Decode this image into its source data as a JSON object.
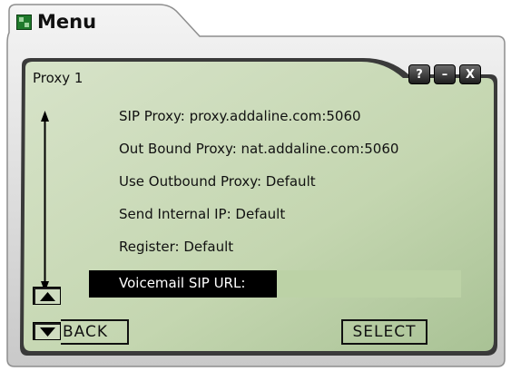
{
  "window": {
    "title": "Menu"
  },
  "controls": {
    "help": "?",
    "minimize": "–",
    "close": "X"
  },
  "screen": {
    "title": "Proxy 1",
    "items": [
      {
        "label": "SIP Proxy: proxy.addaline.com:5060"
      },
      {
        "label": "Out Bound Proxy: nat.addaline.com:5060"
      },
      {
        "label": "Use Outbound Proxy: Default"
      },
      {
        "label": "Send Internal IP: Default"
      },
      {
        "label": "Register: Default"
      }
    ],
    "selected": {
      "label": "Voicemail SIP URL:",
      "value": ""
    }
  },
  "softkeys": {
    "back": "BACK",
    "select": "SELECT"
  },
  "colors": {
    "screen_bg": "#c5d6b4",
    "frame": "#e6e6e6",
    "highlight": "#000000"
  }
}
